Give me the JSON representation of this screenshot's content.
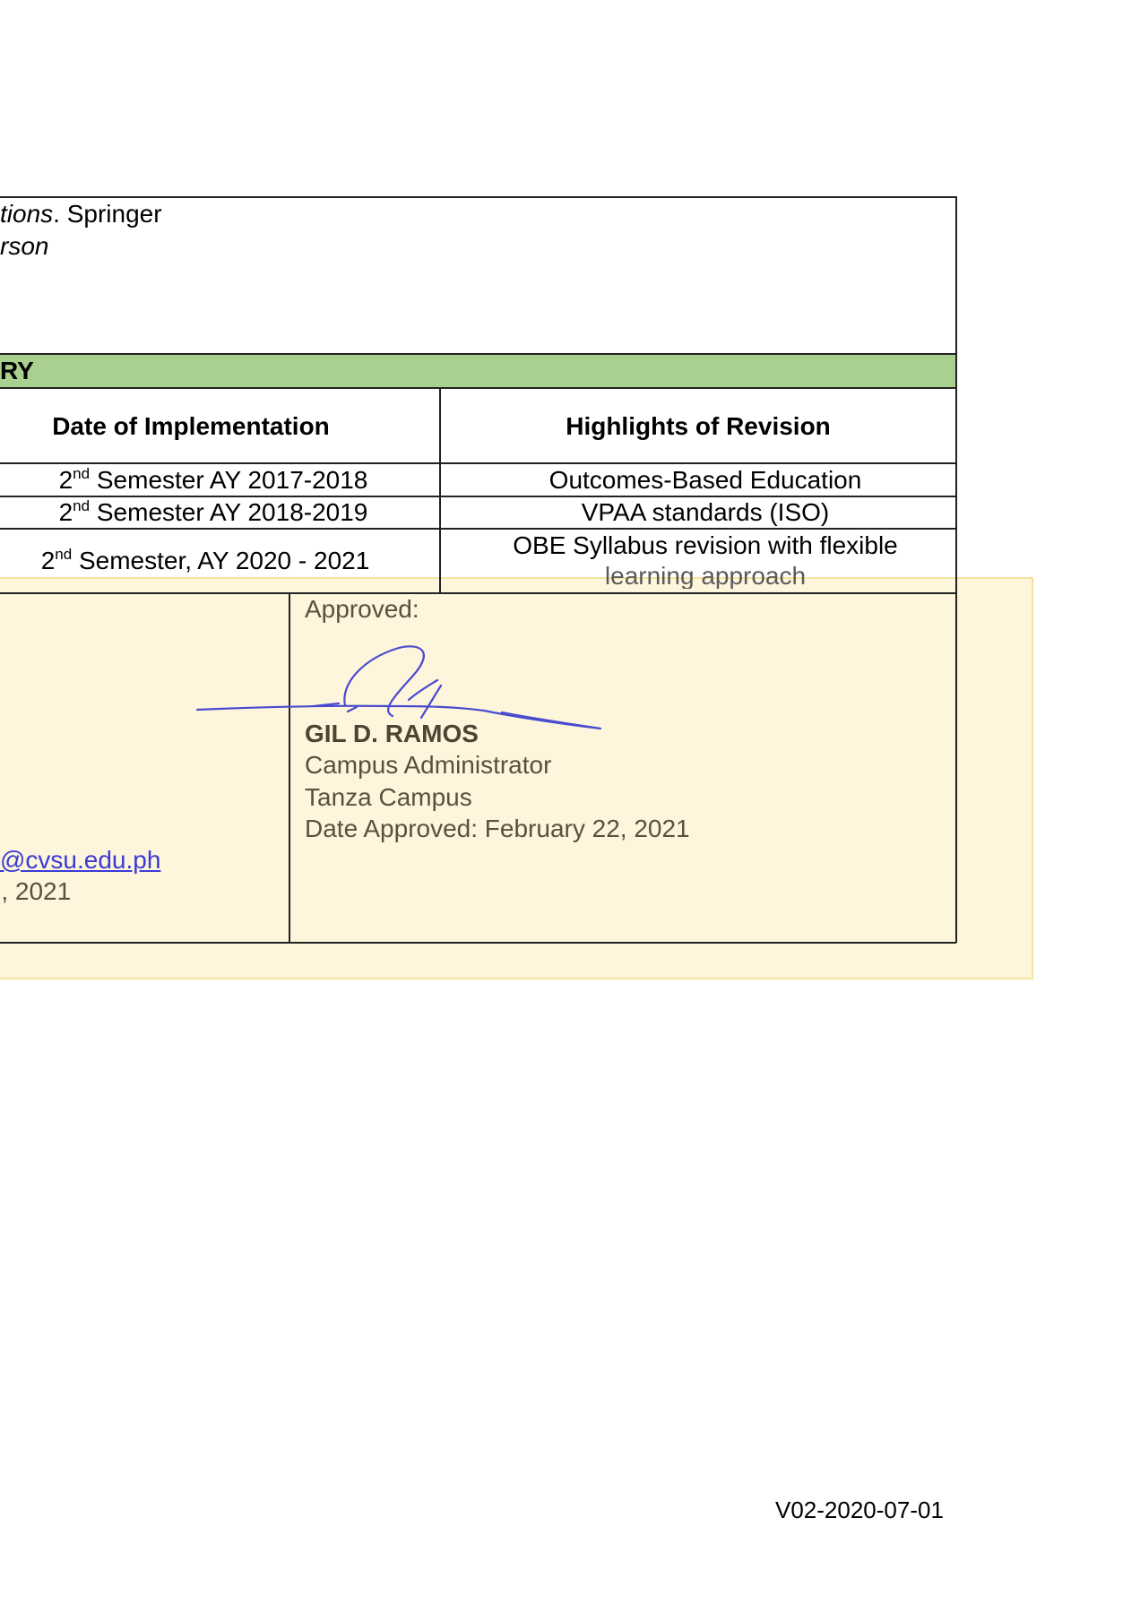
{
  "references": {
    "line1_italic": "tions",
    "line1_rest": ". Springer",
    "line2_italic": "rson"
  },
  "revision_history": {
    "header": "RY",
    "header_color": "#a9d08e",
    "col_date": "Date of Implementation",
    "col_highlights": "Highlights of Revision",
    "rows": [
      {
        "ord": "2",
        "sup": "nd",
        "date": " Semester AY 2017-2018",
        "highlight": "Outcomes-Based Education"
      },
      {
        "ord": "2",
        "sup": "nd",
        "date": " Semester AY 2018-2019",
        "highlight": "VPAA standards (ISO)"
      },
      {
        "ord": "2",
        "sup": "nd",
        "date": " Semester, AY 2020 - 2021",
        "highlight_line1": "OBE Syllabus revision with flexible",
        "highlight_line2": "learning approach"
      }
    ]
  },
  "approval": {
    "label": "Approved:",
    "name": "GIL D. RAMOS",
    "position": "Campus Administrator",
    "campus": "Tanza Campus",
    "date": "Date Approved: February 22, 2021",
    "signature_color": "#4b4bd0"
  },
  "left_panel": {
    "email_partial": "@cvsu.edu.ph",
    "date_partial": "), 2021"
  },
  "overlay_color": "#fdf5dc",
  "footer": {
    "version": "V02-2020-07-01"
  }
}
